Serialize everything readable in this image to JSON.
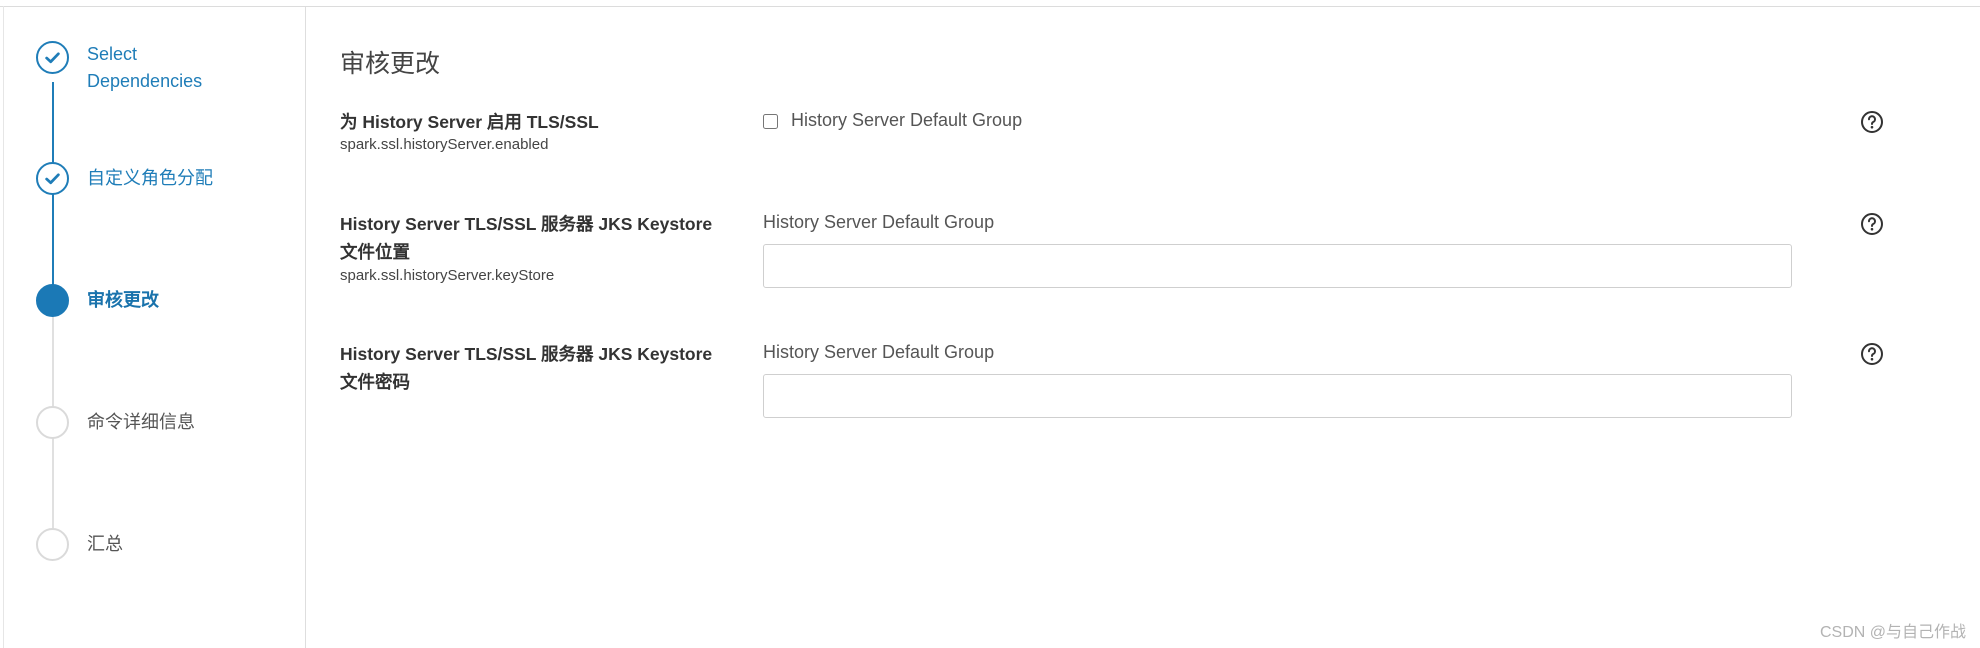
{
  "sidebar": {
    "steps": [
      {
        "label": "Select Dependencies",
        "line1": "Select",
        "line2": "Dependencies",
        "state": "done"
      },
      {
        "label": "自定义角色分配",
        "state": "done"
      },
      {
        "label": "审核更改",
        "state": "active"
      },
      {
        "label": "命令详细信息",
        "state": "pending"
      },
      {
        "label": "汇总",
        "state": "pending"
      }
    ]
  },
  "main": {
    "title": "审核更改",
    "rows": [
      {
        "label": "为 History Server 启用 TLS/SSL",
        "property": "spark.ssl.historyServer.enabled",
        "group": "History Server Default Group",
        "control": "checkbox",
        "checked": false
      },
      {
        "label_line1": "History Server TLS/SSL 服务器 JKS Keystore",
        "label_line2": "文件位置",
        "property": "spark.ssl.historyServer.keyStore",
        "group": "History Server Default Group",
        "control": "text",
        "value": ""
      },
      {
        "label_line1": "History Server TLS/SSL 服务器 JKS Keystore",
        "label_line2": "文件密码",
        "group": "History Server Default Group",
        "control": "password",
        "value": ""
      }
    ]
  },
  "icons": {
    "step_done": "checkmark-icon",
    "help": "question-circle-icon"
  },
  "colors": {
    "accent": "#1b79b6",
    "pending": "#dadada",
    "text": "#333333"
  },
  "watermark": "CSDN @与自己作战"
}
